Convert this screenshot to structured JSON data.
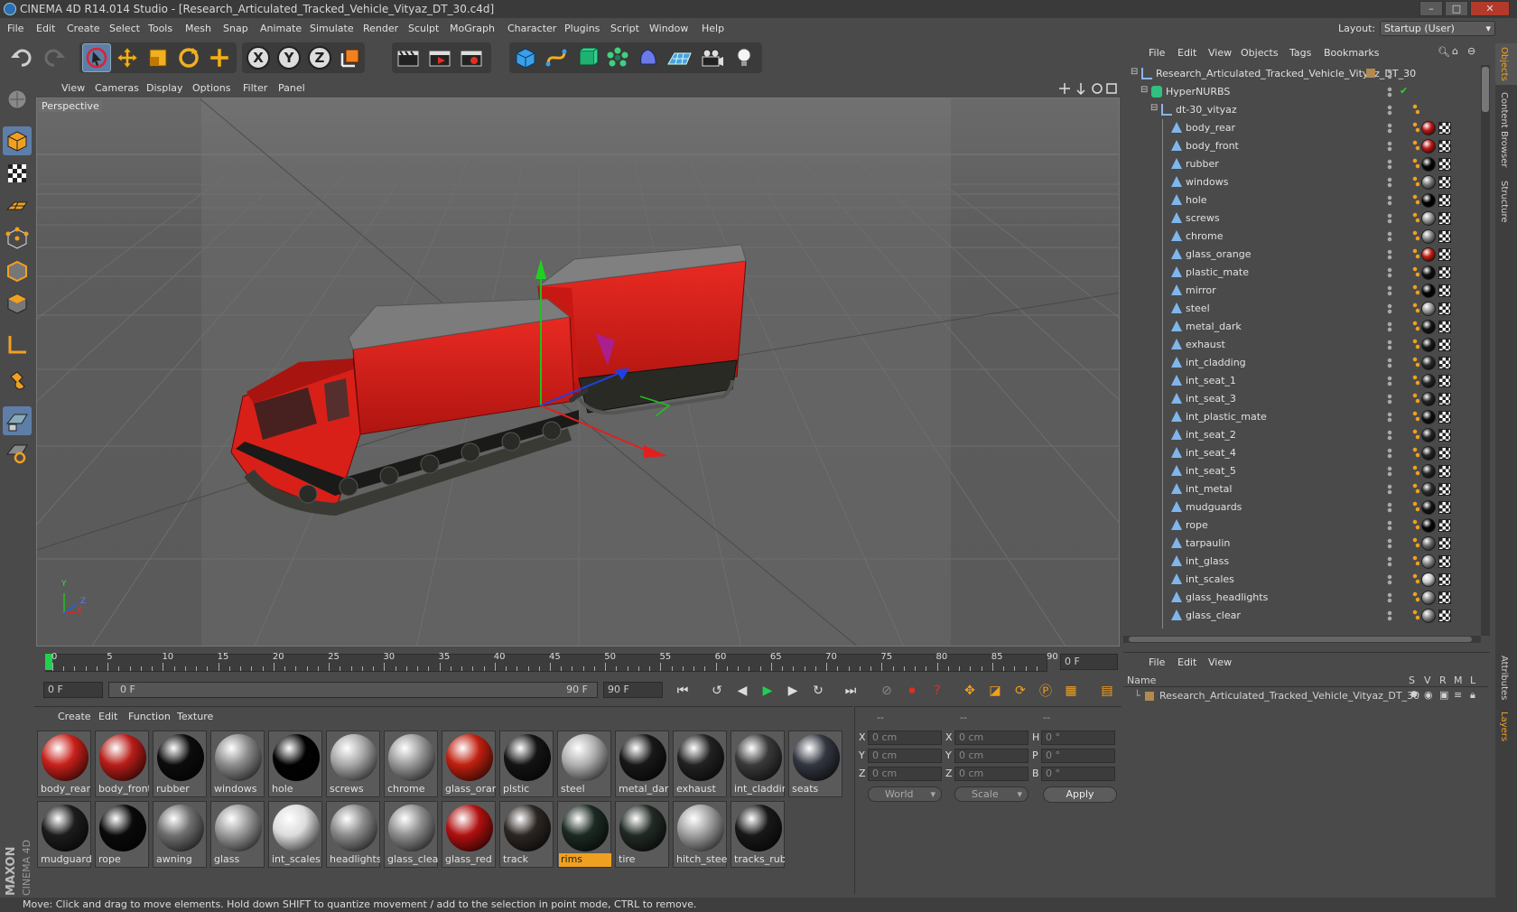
{
  "window": {
    "title": "CINEMA 4D R14.014 Studio - [Research_Articulated_Tracked_Vehicle_Vityaz_DT_30.c4d]",
    "minimize": "–",
    "maximize": "□",
    "close": "✕"
  },
  "menu": {
    "items": [
      "File",
      "Edit",
      "Create",
      "Select",
      "Tools",
      "Mesh",
      "Snap",
      "Animate",
      "Simulate",
      "Render",
      "Sculpt",
      "MoGraph",
      "Character",
      "Plugins",
      "Script",
      "Window",
      "Help"
    ],
    "layout_label": "Layout:",
    "layout_value": "Startup (User)"
  },
  "toolbar": {
    "axis_x": "X",
    "axis_y": "Y",
    "axis_z": "Z",
    "icons": [
      "undo-icon",
      "redo-icon",
      "live-selection-icon",
      "move-icon",
      "scale-icon",
      "rotate-icon",
      "add-icon",
      "x-axis-icon",
      "y-axis-icon",
      "z-axis-icon",
      "coordinate-system-icon",
      "render-view-icon",
      "render-picture-viewer-icon",
      "edit-render-settings-icon",
      "cube-icon",
      "spline-icon",
      "nurbs-icon",
      "array-icon",
      "deformer-icon",
      "floor-icon",
      "camera-icon",
      "light-icon"
    ]
  },
  "viewport": {
    "menu": [
      "View",
      "Cameras",
      "Display",
      "Options",
      "Filter",
      "Panel"
    ],
    "label": "Perspective",
    "axis_labels": {
      "y": "Y",
      "x": "X",
      "z": "Z"
    }
  },
  "timeline": {
    "ticks": [
      "0",
      "5",
      "10",
      "15",
      "20",
      "25",
      "30",
      "35",
      "40",
      "45",
      "50",
      "55",
      "60",
      "65",
      "70",
      "75",
      "80",
      "85",
      "90"
    ],
    "current_frame_display": "0 F",
    "start_frame": "0 F",
    "range_start": "0 F",
    "range_end": "90 F",
    "end_frame": "90 F"
  },
  "material_manager": {
    "menu": [
      "Create",
      "Edit",
      "Function",
      "Texture"
    ],
    "materials": [
      {
        "name": "body_rear",
        "color": "#c8201a",
        "selected": false
      },
      {
        "name": "body_front",
        "color": "#b81d18",
        "selected": false
      },
      {
        "name": "rubber",
        "color": "#0c0c0c",
        "selected": false
      },
      {
        "name": "windows",
        "color": "#8c8c8c",
        "selected": false
      },
      {
        "name": "hole",
        "color": "#020202",
        "selected": false
      },
      {
        "name": "screws",
        "color": "#a8a8a8",
        "selected": false
      },
      {
        "name": "chrome",
        "color": "#9a9a9a",
        "selected": false
      },
      {
        "name": "glass_oran",
        "color": "#c02010",
        "selected": false
      },
      {
        "name": "plstic",
        "color": "#141414",
        "selected": false
      },
      {
        "name": "steel",
        "color": "#b0b0b0",
        "selected": false
      },
      {
        "name": "metal_dark",
        "color": "#181818",
        "selected": false
      },
      {
        "name": "exhaust",
        "color": "#222222",
        "selected": false
      },
      {
        "name": "int_claddin",
        "color": "#3a3a3a",
        "selected": false
      },
      {
        "name": "seats",
        "color": "#333640",
        "selected": false
      },
      {
        "name": "mudguards",
        "color": "#1c1c1c",
        "selected": false
      },
      {
        "name": "rope",
        "color": "#0a0a0a",
        "selected": false
      },
      {
        "name": "awning",
        "color": "#707070",
        "selected": false
      },
      {
        "name": "glass",
        "color": "#9a9a9a",
        "selected": false
      },
      {
        "name": "int_scales",
        "color": "#dcdcdc",
        "selected": false
      },
      {
        "name": "headlights",
        "color": "#8a8a8a",
        "selected": false
      },
      {
        "name": "glass_clear",
        "color": "#8e8e8e",
        "selected": false
      },
      {
        "name": "glass_red",
        "color": "#b01010",
        "selected": false
      },
      {
        "name": "track",
        "color": "#2c2622",
        "selected": false
      },
      {
        "name": "rims",
        "color": "#1c2a22",
        "selected": true
      },
      {
        "name": "tire",
        "color": "#222a24",
        "selected": false
      },
      {
        "name": "hitch_steel",
        "color": "#a0a0a0",
        "selected": false
      },
      {
        "name": "tracks_rubl",
        "color": "#181818",
        "selected": false
      }
    ]
  },
  "coords": {
    "header": [
      "--",
      "--",
      "--"
    ],
    "rows": [
      {
        "l1": "X",
        "v1": "0 cm",
        "l2": "X",
        "v2": "0 cm",
        "l3": "H",
        "v3": "0 °"
      },
      {
        "l1": "Y",
        "v1": "0 cm",
        "l2": "Y",
        "v2": "0 cm",
        "l3": "P",
        "v3": "0 °"
      },
      {
        "l1": "Z",
        "v1": "0 cm",
        "l2": "Z",
        "v2": "0 cm",
        "l3": "B",
        "v3": "0 °"
      }
    ],
    "space_dropdown": "World",
    "mode_dropdown": "Scale",
    "apply": "Apply"
  },
  "object_manager": {
    "menu": [
      "File",
      "Edit",
      "View",
      "Objects",
      "Tags",
      "Bookmarks"
    ],
    "root": "Research_Articulated_Tracked_Vehicle_Vityaz_DT_30",
    "hypernurbs": "HyperNURBS",
    "group": "dt-30_vityaz",
    "children": [
      {
        "name": "body_rear",
        "tag": "#c01818"
      },
      {
        "name": "body_front",
        "tag": "#c01818"
      },
      {
        "name": "rubber",
        "tag": "#080808"
      },
      {
        "name": "windows",
        "tag": "#7a7a7a"
      },
      {
        "name": "hole",
        "tag": "#000000"
      },
      {
        "name": "screws",
        "tag": "#9a9a9a"
      },
      {
        "name": "chrome",
        "tag": "#8a8a8a"
      },
      {
        "name": "glass_orange",
        "tag": "#c02010"
      },
      {
        "name": "plastic_mate",
        "tag": "#101010"
      },
      {
        "name": "mirror",
        "tag": "#050505"
      },
      {
        "name": "steel",
        "tag": "#a0a0a0"
      },
      {
        "name": "metal_dark",
        "tag": "#151515"
      },
      {
        "name": "exhaust",
        "tag": "#1a1a1a"
      },
      {
        "name": "int_cladding",
        "tag": "#2c2c2c"
      },
      {
        "name": "int_seat_1",
        "tag": "#262626"
      },
      {
        "name": "int_seat_3",
        "tag": "#262626"
      },
      {
        "name": "int_plastic_mate",
        "tag": "#101010"
      },
      {
        "name": "int_seat_2",
        "tag": "#262626"
      },
      {
        "name": "int_seat_4",
        "tag": "#262626"
      },
      {
        "name": "int_seat_5",
        "tag": "#262626"
      },
      {
        "name": "int_metal",
        "tag": "#303030"
      },
      {
        "name": "mudguards",
        "tag": "#151515"
      },
      {
        "name": "rope",
        "tag": "#080808"
      },
      {
        "name": "tarpaulin",
        "tag": "#6a6a6a"
      },
      {
        "name": "int_glass",
        "tag": "#8a8a8a"
      },
      {
        "name": "int_scales",
        "tag": "#cfcfcf"
      },
      {
        "name": "glass_headlights",
        "tag": "#8a8a8a"
      },
      {
        "name": "glass_clear",
        "tag": "#8a8a8a"
      }
    ]
  },
  "layer_manager": {
    "menu": [
      "File",
      "Edit",
      "View"
    ],
    "col_name": "Name",
    "cols": [
      "S",
      "V",
      "R",
      "M",
      "L"
    ],
    "row": "Research_Articulated_Tracked_Vehicle_Vityaz_DT_30"
  },
  "right_tabs": [
    "Objects",
    "Content Browser",
    "Structure"
  ],
  "right_tabs_lower": [
    "Attributes",
    "Layers"
  ],
  "logo": {
    "line1": "MAXON",
    "line2": "CINEMA 4D"
  },
  "status": "Move: Click and drag to move elements. Hold down SHIFT to quantize movement / add to the selection in point mode, CTRL to remove.",
  "colors": {
    "accent": "#5e7ea8",
    "highlight": "#f0a020",
    "vehicle_red": "#d41c1c"
  }
}
